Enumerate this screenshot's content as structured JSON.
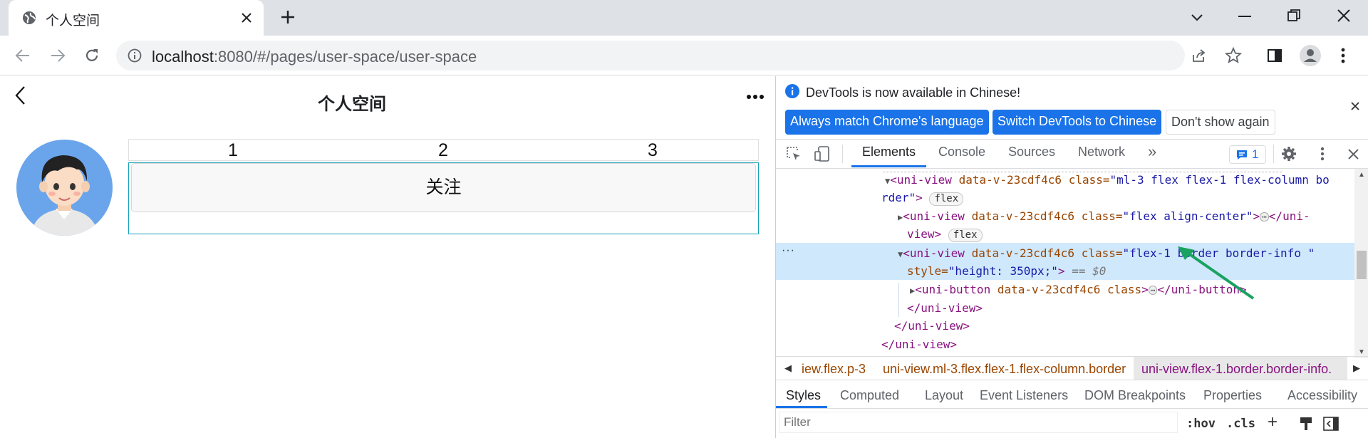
{
  "browser": {
    "tab_title": "个人空间",
    "new_tab_label": "+",
    "url_host": "localhost",
    "url_path": ":8080/#/pages/user-space/user-space"
  },
  "app": {
    "nav_title": "个人空间",
    "tabs": [
      "1",
      "2",
      "3"
    ],
    "follow_button": "关注"
  },
  "devtools": {
    "info_text": "DevTools is now available in Chinese!",
    "btn_match": "Always match Chrome's language",
    "btn_switch": "Switch DevTools to Chinese",
    "btn_dismiss": "Don't show again",
    "panel_tabs": [
      "Elements",
      "Console",
      "Sources",
      "Network"
    ],
    "more_tabs": "»",
    "issues_count": "1",
    "dom": {
      "l1_tag": "<uni-view",
      "l1_attr": " data-v-23cdf4c6 class=",
      "l1_val": "\"ml-3 flex flex-1 flex-column bo",
      "l1b_val": "rder\"",
      "l1b_tag": ">",
      "badge_flex": "flex",
      "l2_tag": "<uni-view",
      "l2_attr": " data-v-23cdf4c6 class=",
      "l2_val": "\"flex align-center\"",
      "l2_tag2": ">",
      "l2_close": "</uni-",
      "l2b_close": "view>",
      "l3_tag": "<uni-view",
      "l3_attr": " data-v-23cdf4c6 class=",
      "l3_val": "\"flex-1 border border-info \"",
      "l3b_attr": "style=",
      "l3b_val": "\"height: 350px;\"",
      "l3b_tag": ">",
      "l3b_eq": " == $0",
      "l4_tag": "<uni-button",
      "l4_attr": " data-v-23cdf4c6 class",
      "l4_tag2": ">",
      "l4_close": "</uni-button>",
      "l5": "</uni-view>",
      "l6": "</uni-view>",
      "l7": "</uni-view>"
    },
    "breadcrumbs": [
      "iew.flex.p-3",
      "uni-view.ml-3.flex.flex-1.flex-column.border",
      "uni-view.flex-1.border.border-info."
    ],
    "sub_tabs": [
      "Styles",
      "Computed",
      "Layout",
      "Event Listeners",
      "DOM Breakpoints",
      "Properties",
      "Accessibility"
    ],
    "filter_placeholder": "Filter",
    "hov": ":hov",
    "cls": ".cls",
    "plus": "+"
  },
  "colors": {
    "accent": "#1a73e8",
    "selected_row": "#cfe8fc",
    "arrow": "#1aa260",
    "avatar_bg": "#6aa5ec",
    "border_info": "#17a2b8"
  }
}
